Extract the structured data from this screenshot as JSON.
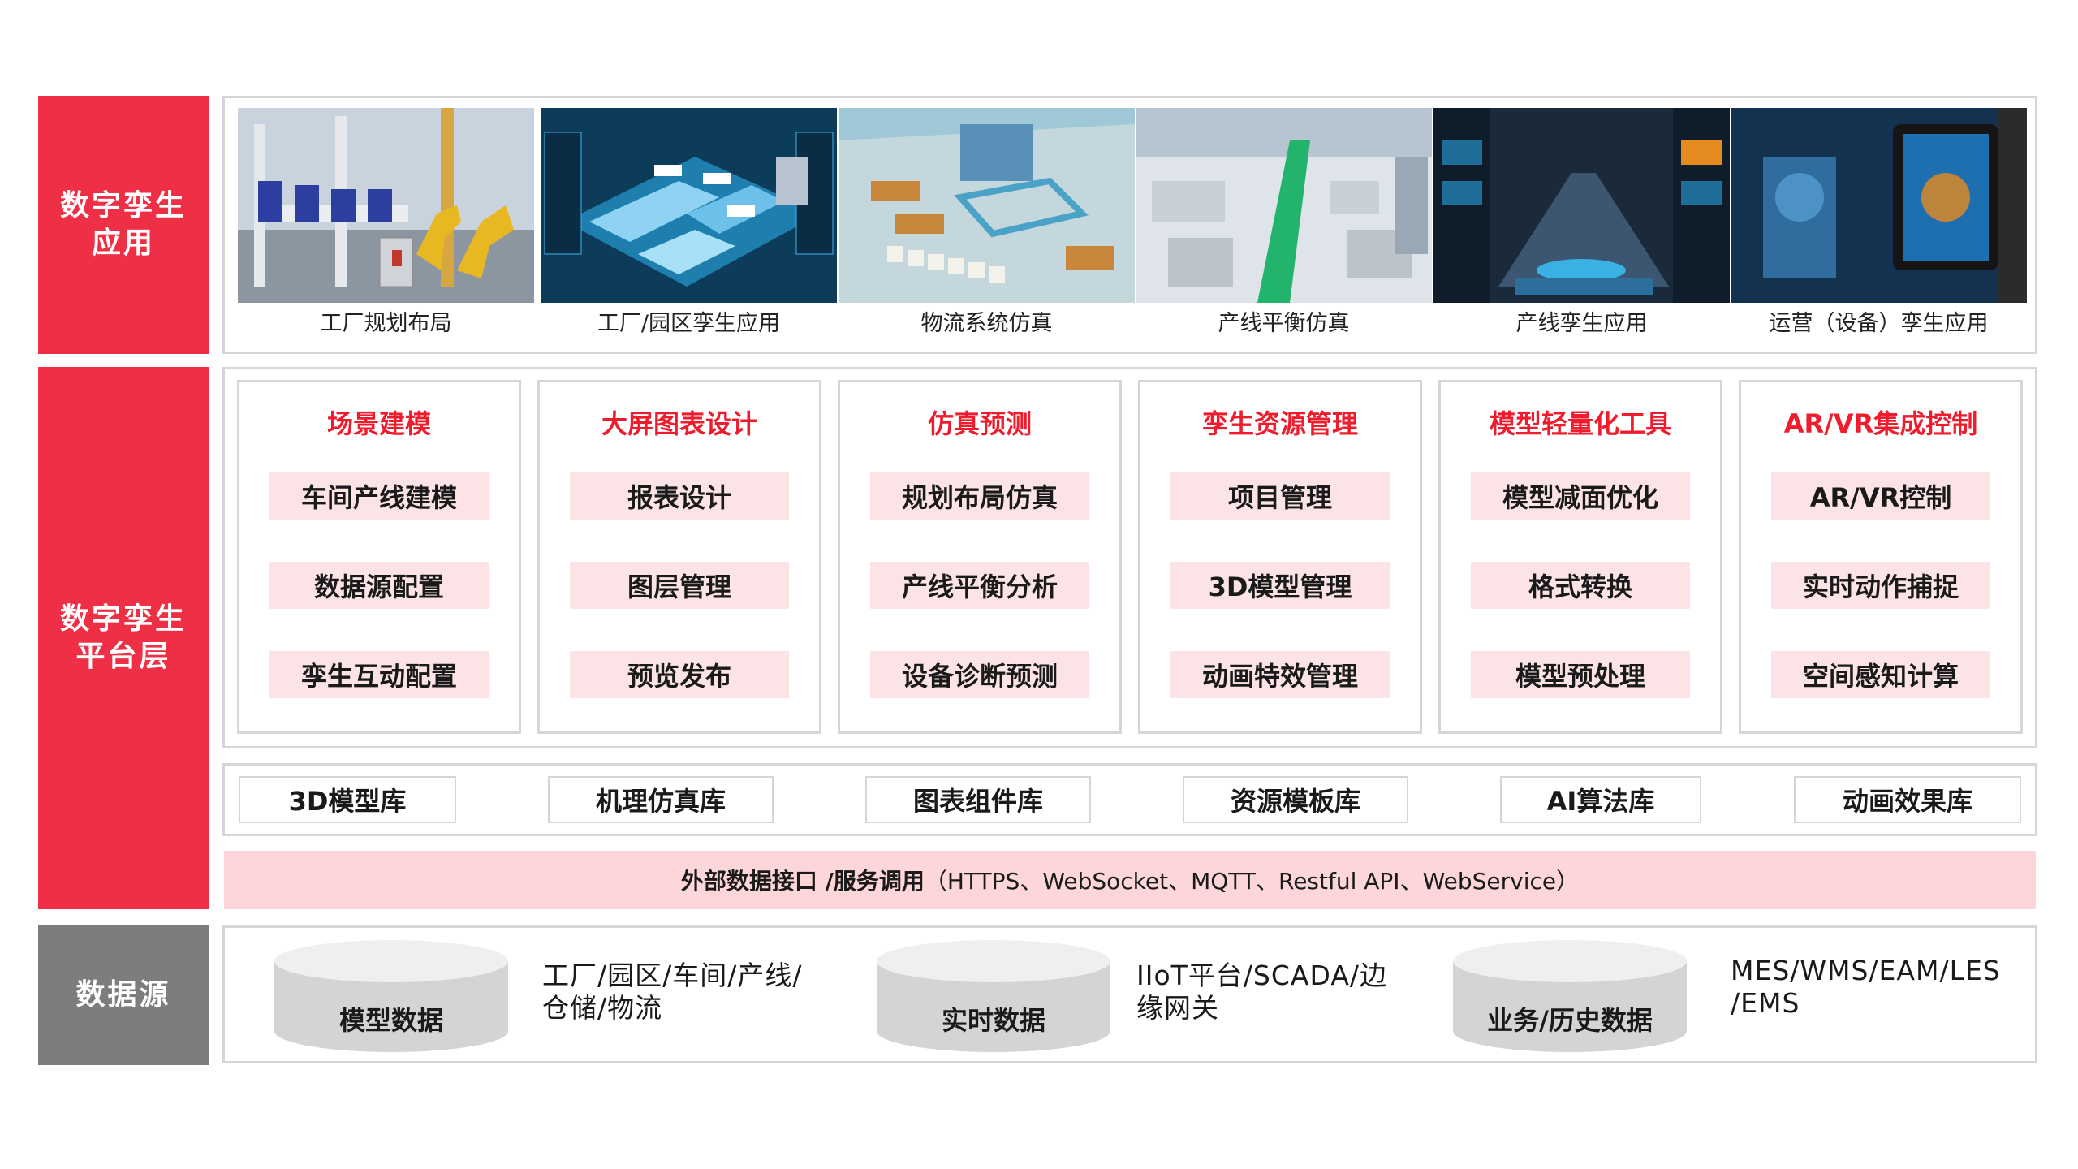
{
  "layers": {
    "app": {
      "line1": "数字孪生",
      "line2": "应用"
    },
    "platform": {
      "line1": "数字孪生",
      "line2": "平台层"
    },
    "source": {
      "line1": "数据源"
    }
  },
  "applications": [
    {
      "caption": "工厂规划布局",
      "icon": "factory-floor-image"
    },
    {
      "caption": "工厂/园区孪生应用",
      "icon": "park-twin-image"
    },
    {
      "caption": "物流系统仿真",
      "icon": "logistics-image"
    },
    {
      "caption": "产线平衡仿真",
      "icon": "production-line-image"
    },
    {
      "caption": "产线孪生应用",
      "icon": "line-twin-image"
    },
    {
      "caption": "运营（设备）孪生应用",
      "icon": "operations-ar-image"
    }
  ],
  "modules": [
    {
      "title": "场景建模",
      "features": [
        "车间产线建模",
        "数据源配置",
        "孪生互动配置"
      ]
    },
    {
      "title": "大屏图表设计",
      "features": [
        "报表设计",
        "图层管理",
        "预览发布"
      ]
    },
    {
      "title": "仿真预测",
      "features": [
        "规划布局仿真",
        "产线平衡分析",
        "设备诊断预测"
      ]
    },
    {
      "title": "孪生资源管理",
      "features": [
        "项目管理",
        "3D模型管理",
        "动画特效管理"
      ]
    },
    {
      "title": "模型轻量化工具",
      "features": [
        "模型减面优化",
        "格式转换",
        "模型预处理"
      ]
    },
    {
      "title": "AR/VR集成控制",
      "features": [
        "AR/VR控制",
        "实时动作捕捉",
        "空间感知计算"
      ]
    }
  ],
  "libraries": [
    "3D模型库",
    "机理仿真库",
    "图表组件库",
    "资源模板库",
    "AI算法库",
    "动画效果库"
  ],
  "interface": {
    "part1": "外部数据接口 / ",
    "part2": "服务调用",
    "part3": "（HTTPS、WebSocket、MQTT、Restful API、WebService）"
  },
  "sources": [
    {
      "label": "模型数据",
      "desc1": "工厂/园区/车间/产线/",
      "desc2": "仓储/物流"
    },
    {
      "label": "实时数据",
      "desc1": "IIoT平台/SCADA/边",
      "desc2": "缘网关"
    },
    {
      "label": "业务/历史数据",
      "desc1": "MES/WMS/EAM/LES",
      "desc2": "/EMS"
    }
  ],
  "colors": {
    "accent": "#ef2f45",
    "title_red": "#ef1c2e",
    "feature_bg": "#fbe3e6",
    "gray": "#7d7d7d"
  }
}
